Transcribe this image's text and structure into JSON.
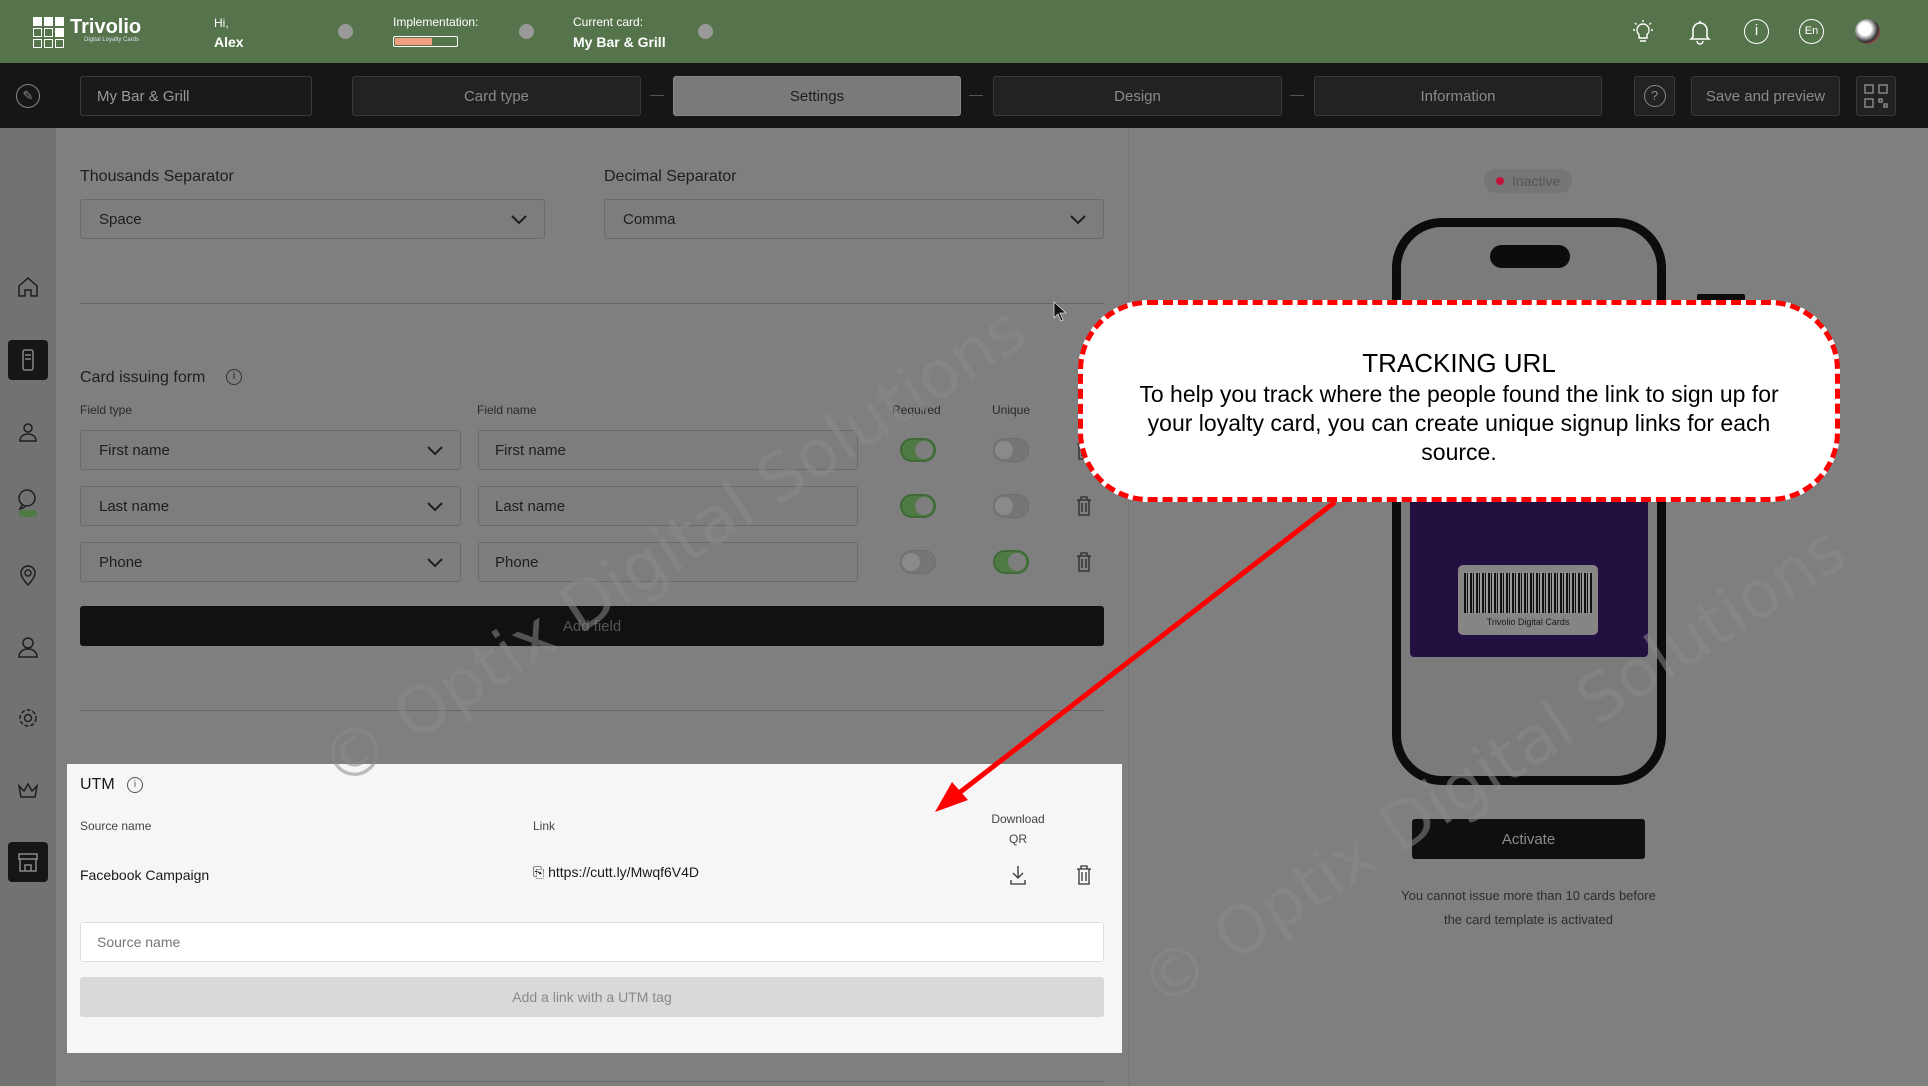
{
  "header": {
    "brand": "Trivolio",
    "brand_sub": "Digital Loyalty Cards",
    "greeting": "Hi,",
    "user": "Alex",
    "implementation_label": "Implementation:",
    "implementation_progress": 0.6,
    "current_card_label": "Current card:",
    "current_card": "My Bar & Grill",
    "lang": "En"
  },
  "toolbar": {
    "card_name": "My Bar & Grill",
    "steps": [
      "Card type",
      "Settings",
      "Design",
      "Information"
    ],
    "active_step": "Settings",
    "save_label": "Save and preview"
  },
  "settings": {
    "thousands_label": "Thousands Separator",
    "thousands_value": "Space",
    "decimal_label": "Decimal Separator",
    "decimal_value": "Comma"
  },
  "form": {
    "title": "Card issuing form",
    "col_type": "Field type",
    "col_name": "Field name",
    "col_required": "Required",
    "col_unique": "Unique",
    "rows": [
      {
        "type": "First name",
        "name": "First name",
        "required": true,
        "unique": false
      },
      {
        "type": "Last name",
        "name": "Last name",
        "required": true,
        "unique": false
      },
      {
        "type": "Phone",
        "name": "Phone",
        "required": false,
        "unique": true
      }
    ],
    "add_label": "Add field"
  },
  "utm": {
    "title": "UTM",
    "col_source": "Source name",
    "col_link": "Link",
    "col_download": "Download",
    "col_download2": "QR",
    "rows": [
      {
        "source": "Facebook Campaign",
        "link": "https://cutt.ly/Mwqf6V4D"
      }
    ],
    "source_placeholder": "Source name",
    "add_label": "Add a link with a UTM tag"
  },
  "preview": {
    "status": "Inactive",
    "status_color": "#c0143c",
    "card_brand": "Trivolio Digital Cards",
    "card_color": "#221040",
    "activate_label": "Activate",
    "note_line1": "You cannot issue more than 10 cards before",
    "note_line2": "the card template is activated"
  },
  "callout": {
    "title": "TRACKING URL",
    "body": "To help you track where the people found the link to sign up for your loyalty card, you can create unique signup links for each source."
  },
  "watermark": "© Optix Digital Solutions"
}
